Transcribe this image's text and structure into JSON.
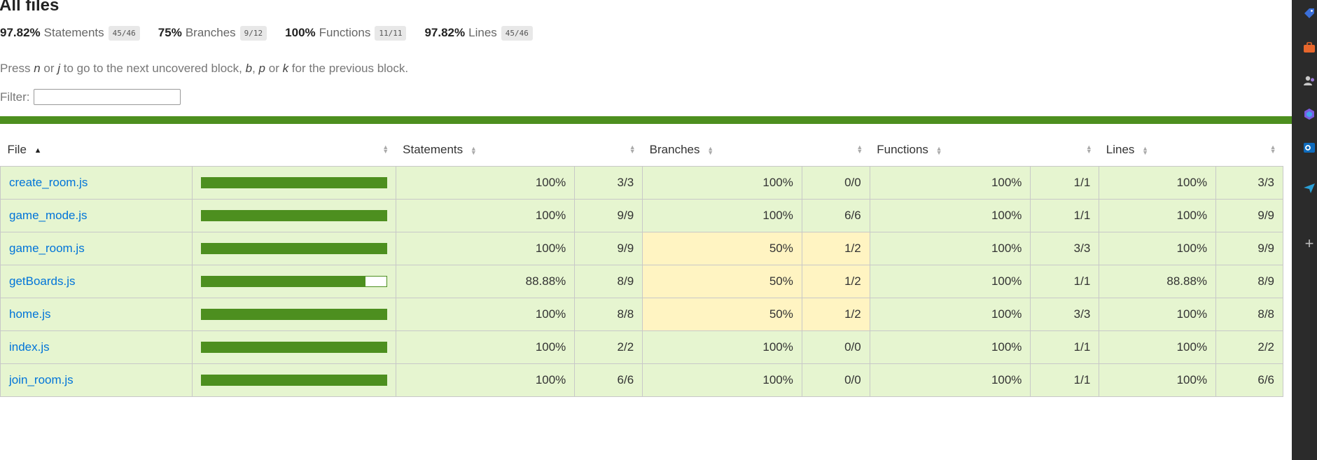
{
  "page": {
    "title": "All files",
    "summary": [
      {
        "pct": "97.82%",
        "label": "Statements",
        "fraction": "45/46"
      },
      {
        "pct": "75%",
        "label": "Branches",
        "fraction": "9/12"
      },
      {
        "pct": "100%",
        "label": "Functions",
        "fraction": "11/11"
      },
      {
        "pct": "97.82%",
        "label": "Lines",
        "fraction": "45/46"
      }
    ],
    "hint": {
      "p1": "Press ",
      "k1": "n",
      "p2": " or ",
      "k2": "j",
      "p3": " to go to the next uncovered block, ",
      "k3": "b",
      "p4": ", ",
      "k4": "p",
      "p5": " or ",
      "k5": "k",
      "p6": " for the previous block."
    },
    "filter_label": "Filter:",
    "filter_value": ""
  },
  "table": {
    "headers": {
      "file": "File",
      "statements": "Statements",
      "branches": "Branches",
      "functions": "Functions",
      "lines": "Lines"
    },
    "rows": [
      {
        "file": "create_room.js",
        "coverage": 1.0,
        "st_pct": "100%",
        "st_frac": "3/3",
        "br_pct": "100%",
        "br_frac": "0/0",
        "fn_pct": "100%",
        "fn_frac": "1/1",
        "ln_pct": "100%",
        "ln_frac": "3/3"
      },
      {
        "file": "game_mode.js",
        "coverage": 1.0,
        "st_pct": "100%",
        "st_frac": "9/9",
        "br_pct": "100%",
        "br_frac": "6/6",
        "fn_pct": "100%",
        "fn_frac": "1/1",
        "ln_pct": "100%",
        "ln_frac": "9/9"
      },
      {
        "file": "game_room.js",
        "coverage": 1.0,
        "st_pct": "100%",
        "st_frac": "9/9",
        "br_pct": "50%",
        "br_frac": "1/2",
        "fn_pct": "100%",
        "fn_frac": "3/3",
        "ln_pct": "100%",
        "ln_frac": "9/9"
      },
      {
        "file": "getBoards.js",
        "coverage": 0.8888,
        "st_pct": "88.88%",
        "st_frac": "8/9",
        "br_pct": "50%",
        "br_frac": "1/2",
        "fn_pct": "100%",
        "fn_frac": "1/1",
        "ln_pct": "88.88%",
        "ln_frac": "8/9"
      },
      {
        "file": "home.js",
        "coverage": 1.0,
        "st_pct": "100%",
        "st_frac": "8/8",
        "br_pct": "50%",
        "br_frac": "1/2",
        "fn_pct": "100%",
        "fn_frac": "3/3",
        "ln_pct": "100%",
        "ln_frac": "8/8"
      },
      {
        "file": "index.js",
        "coverage": 1.0,
        "st_pct": "100%",
        "st_frac": "2/2",
        "br_pct": "100%",
        "br_frac": "0/0",
        "fn_pct": "100%",
        "fn_frac": "1/1",
        "ln_pct": "100%",
        "ln_frac": "2/2"
      },
      {
        "file": "join_room.js",
        "coverage": 1.0,
        "st_pct": "100%",
        "st_frac": "6/6",
        "br_pct": "100%",
        "br_frac": "0/0",
        "fn_pct": "100%",
        "fn_frac": "1/1",
        "ln_pct": "100%",
        "ln_frac": "6/6"
      }
    ]
  },
  "colors": {
    "high_bg": "#e6f5d0",
    "medium_bg": "#fff4c2",
    "bar_green": "#4d8f1f",
    "link": "#0074d9"
  },
  "sidebar_icons": [
    "tag-icon",
    "briefcase-icon",
    "people-icon",
    "copilot-icon",
    "outlook-icon",
    "send-icon",
    "plus-icon"
  ]
}
